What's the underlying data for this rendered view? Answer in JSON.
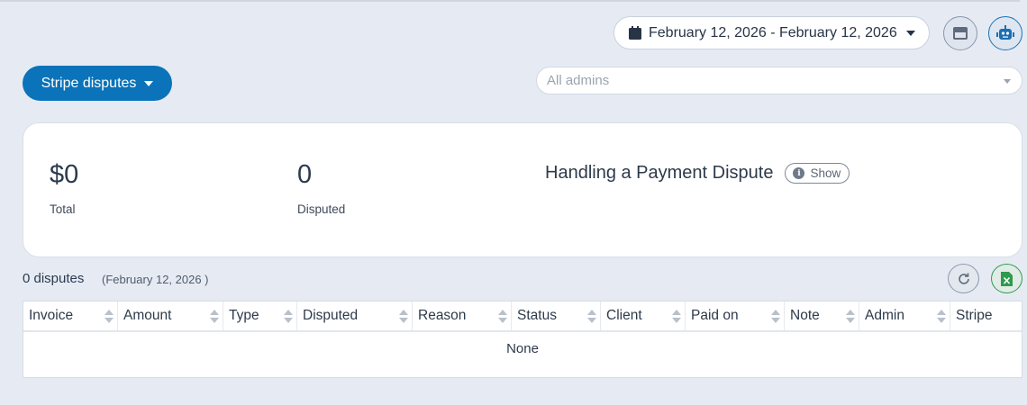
{
  "date_range": {
    "label": "February 12, 2026 - February 12, 2026",
    "icon": "calendar-icon"
  },
  "toolbar": {
    "layout_icon": "panel-icon",
    "bot_icon": "robot-icon"
  },
  "source_dropdown": {
    "label": "Stripe disputes"
  },
  "admin_filter": {
    "placeholder": "All admins"
  },
  "summary": {
    "total_value": "$0",
    "total_label": "Total",
    "disputed_value": "0",
    "disputed_label": "Disputed",
    "help_title": "Handling a Payment Dispute",
    "show_label": "Show"
  },
  "list": {
    "count_label": "0 disputes",
    "date_label": "(February 12, 2026 )"
  },
  "table": {
    "columns": [
      "Invoice",
      "Amount",
      "Type",
      "Disputed",
      "Reason",
      "Status",
      "Client",
      "Paid on",
      "Note",
      "Admin",
      "Stripe"
    ],
    "empty_text": "None"
  },
  "colors": {
    "primary": "#0a73b9",
    "background": "#e6ebf3",
    "excel": "#2e9a4d"
  }
}
